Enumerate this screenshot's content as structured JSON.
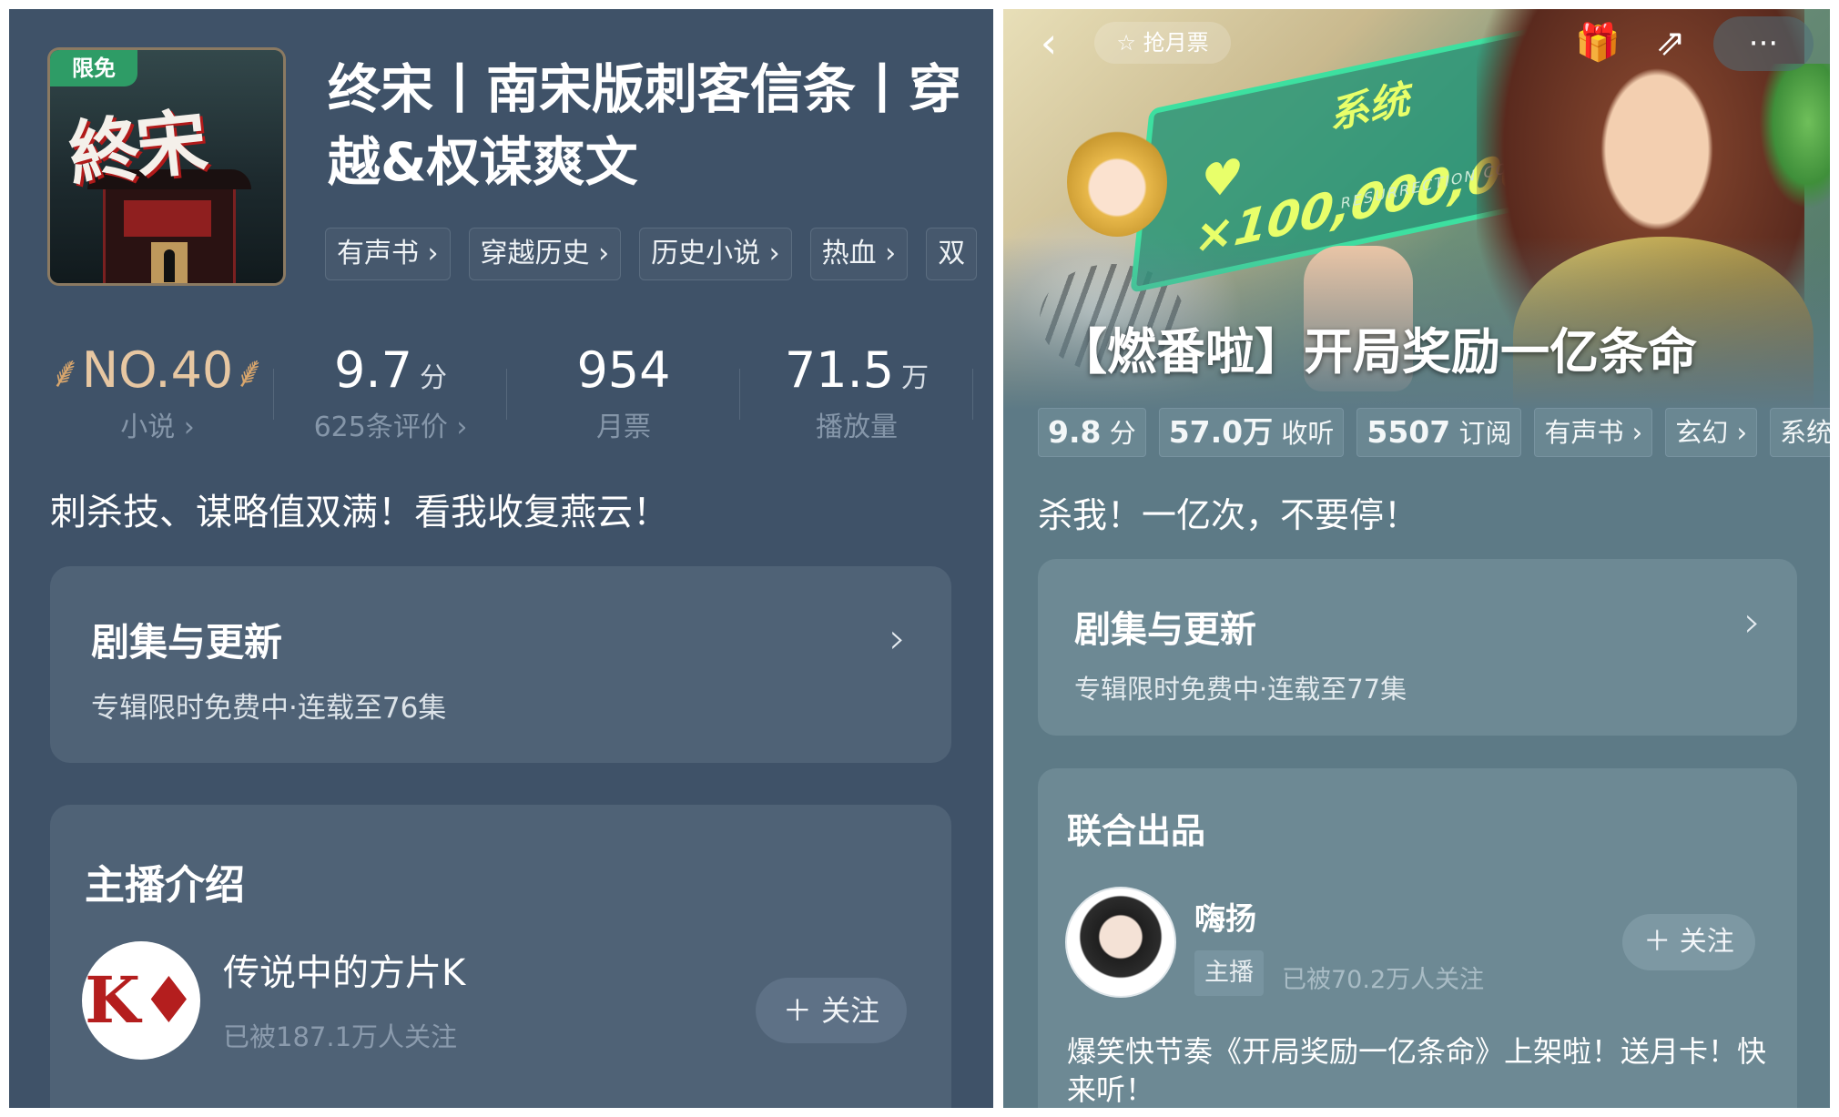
{
  "left": {
    "cover": {
      "badge": "限免",
      "title": "終宋"
    },
    "title": "终宋丨南宋版刺客信条丨穿越&权谋爽文",
    "tags": [
      "有声书 ›",
      "穿越历史 ›",
      "历史小说 ›",
      "热血 ›",
      "双"
    ],
    "stats": {
      "rank": {
        "value": "NO.40",
        "label": "小说 ›"
      },
      "score": {
        "value": "9.7",
        "unit": "分",
        "label": "625条评价 ›"
      },
      "monthly": {
        "value": "954",
        "label": "月票"
      },
      "plays": {
        "value": "71.5",
        "unit": "万",
        "label": "播放量"
      }
    },
    "slogan": "刺杀技、谋略值双满！看我收复燕云！",
    "episodes": {
      "title": "剧集与更新",
      "subtitle": "专辑限时免费中·连载至76集",
      "chevron": "›"
    },
    "host": {
      "section_title": "主播介绍",
      "name": "传说中的方片K",
      "fans": "已被187.1万人关注",
      "follow_label": "＋ 关注",
      "avatar_glyph": "K♦"
    }
  },
  "right": {
    "topbar": {
      "back": "‹",
      "listen": "☆ 抢月票",
      "gift": "🎁",
      "share": "⇗",
      "more": "···"
    },
    "banner": {
      "sys_label": "系统",
      "sys_amount": "♥ ×100,000,000",
      "sys_coin": "RESURRECTION COIN"
    },
    "title": "【燃番啦】开局奖励一亿条命",
    "tags": [
      {
        "value": "9.8",
        "unit": "分"
      },
      {
        "value": "57.0万",
        "unit": "收听"
      },
      {
        "value": "5507",
        "unit": "订阅"
      },
      {
        "value": "",
        "unit": "有声书 ›"
      },
      {
        "value": "",
        "unit": "玄幻 ›"
      },
      {
        "value": "",
        "unit": "系统"
      }
    ],
    "slogan": "杀我！一亿次，不要停！",
    "episodes": {
      "title": "剧集与更新",
      "subtitle": "专辑限时免费中·连载至77集",
      "chevron": "›"
    },
    "joint": {
      "section_title": "联合出品",
      "name": "嗨扬",
      "role": "主播",
      "fans": "已被70.2万人关注",
      "follow_label": "＋ 关注",
      "description": "爆笑快节奏《开局奖励一亿条命》上架啦！送月卡！快来听！"
    }
  },
  "colors": {
    "left_bg": "#3f5268",
    "right_bg": "#5d7a86",
    "rank_gold": "#e7c7a2",
    "cover_badge": "#2e9c66"
  }
}
